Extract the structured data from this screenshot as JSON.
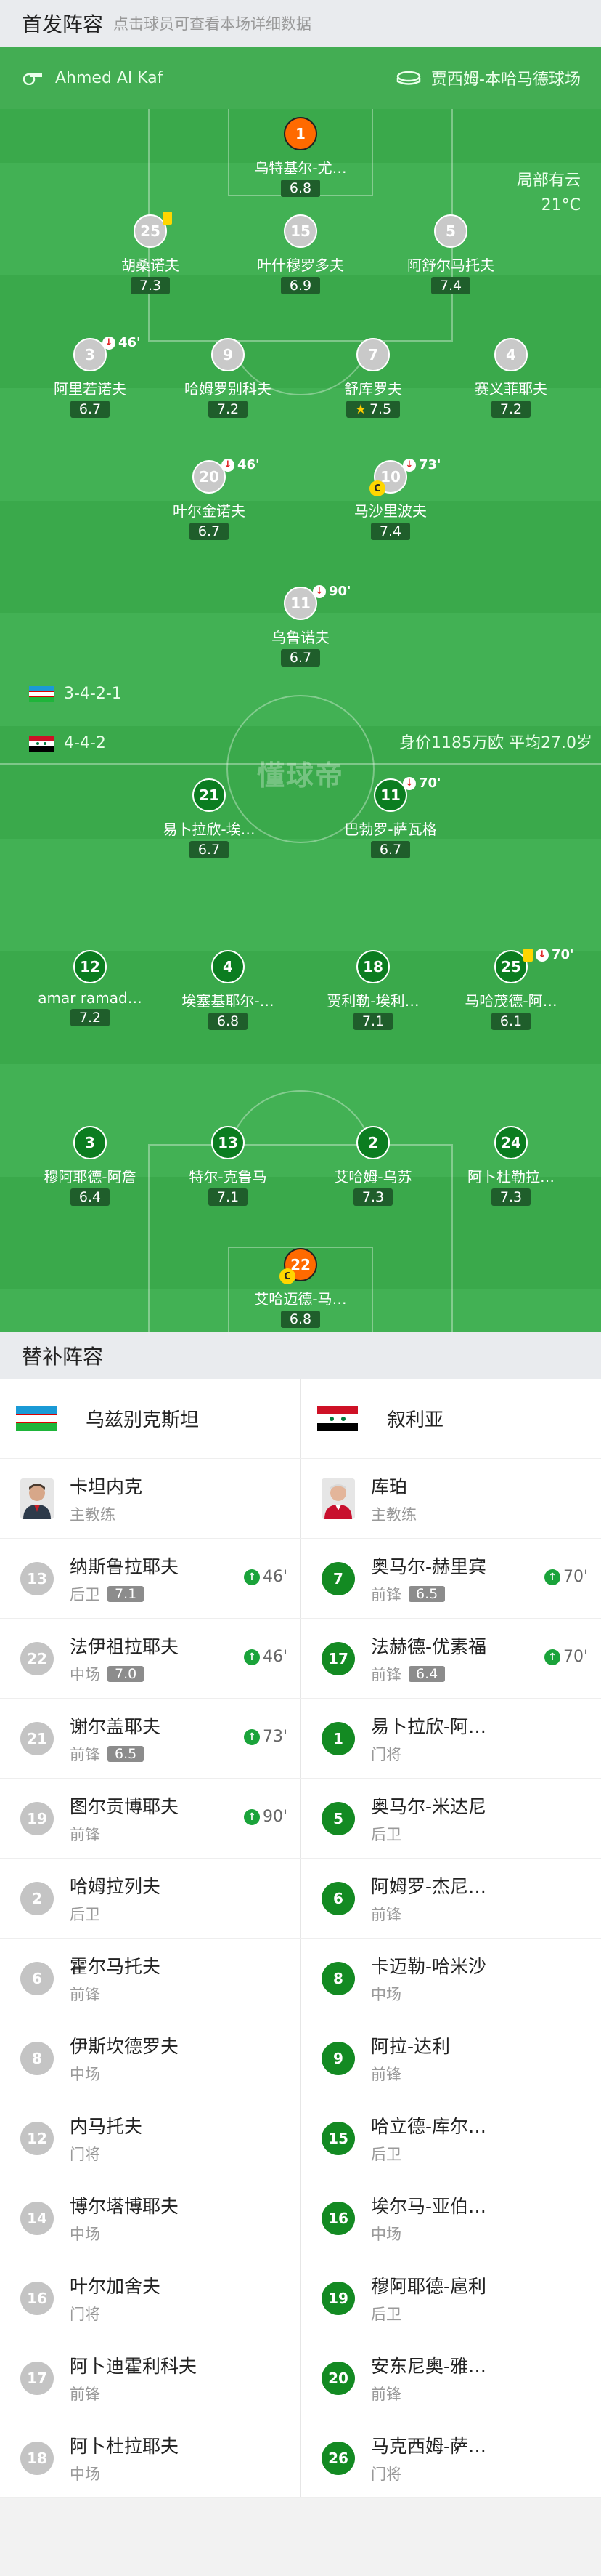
{
  "header": {
    "title": "首发阵容",
    "subtitle": "点击球员可查看本场详细数据"
  },
  "match_info": {
    "referee": "Ahmed Al Kaf",
    "stadium": "贾西姆-本哈马德球场",
    "weather": "局部有云",
    "temperature": "21°C"
  },
  "watermark": "懂球帝",
  "home": {
    "formation": "3-4-2-1",
    "value_text": "身价1185万欧  平均27.0岁",
    "players": [
      {
        "num": "1",
        "name": "乌特基尔-尤…",
        "rating": "6.8",
        "style": "orange"
      },
      {
        "num": "25",
        "name": "胡桑诺夫",
        "rating": "7.3",
        "style": "grey",
        "card": true
      },
      {
        "num": "15",
        "name": "叶什穆罗多夫",
        "rating": "6.9",
        "style": "grey"
      },
      {
        "num": "5",
        "name": "阿舒尔马托夫",
        "rating": "7.4",
        "style": "grey"
      },
      {
        "num": "3",
        "name": "阿里若诺夫",
        "rating": "6.7",
        "style": "grey",
        "sub": "46'"
      },
      {
        "num": "9",
        "name": "哈姆罗别科夫",
        "rating": "7.2",
        "style": "grey"
      },
      {
        "num": "7",
        "name": "舒库罗夫",
        "rating": "7.5",
        "style": "grey",
        "star": true
      },
      {
        "num": "4",
        "name": "赛义菲耶夫",
        "rating": "7.2",
        "style": "grey"
      },
      {
        "num": "20",
        "name": "叶尔金诺夫",
        "rating": "6.7",
        "style": "grey",
        "sub": "46'"
      },
      {
        "num": "10",
        "name": "马沙里波夫",
        "rating": "7.4",
        "style": "grey",
        "sub": "73'",
        "captain": true
      },
      {
        "num": "11",
        "name": "乌鲁诺夫",
        "rating": "6.7",
        "style": "grey",
        "sub": "90'"
      }
    ]
  },
  "away": {
    "formation": "4-4-2",
    "players": [
      {
        "num": "21",
        "name": "易卜拉欣-埃…",
        "rating": "6.7",
        "style": "green"
      },
      {
        "num": "11",
        "name": "巴勃罗-萨瓦格",
        "rating": "6.7",
        "style": "green",
        "sub": "70'"
      },
      {
        "num": "12",
        "name": "amar ramad…",
        "rating": "7.2",
        "style": "green"
      },
      {
        "num": "4",
        "name": "埃塞基耶尔-…",
        "rating": "6.8",
        "style": "green"
      },
      {
        "num": "18",
        "name": "贾利勒-埃利…",
        "rating": "7.1",
        "style": "green"
      },
      {
        "num": "25",
        "name": "马哈茂德-阿…",
        "rating": "6.1",
        "style": "green",
        "card": true,
        "sub": "70'"
      },
      {
        "num": "3",
        "name": "穆阿耶德-阿詹",
        "rating": "6.4",
        "style": "green"
      },
      {
        "num": "13",
        "name": "特尔-克鲁马",
        "rating": "7.1",
        "style": "green"
      },
      {
        "num": "2",
        "name": "艾哈姆-乌苏",
        "rating": "7.3",
        "style": "green"
      },
      {
        "num": "24",
        "name": "阿卜杜勒拉…",
        "rating": "7.3",
        "style": "green"
      },
      {
        "num": "22",
        "name": "艾哈迈德-马…",
        "rating": "6.8",
        "style": "orange",
        "captain": true
      }
    ]
  },
  "subs": {
    "title": "替补阵容",
    "home_team": "乌兹别克斯坦",
    "away_team": "叙利亚",
    "home_coach": {
      "name": "卡坦内克",
      "role": "主教练"
    },
    "away_coach": {
      "name": "库珀",
      "role": "主教练"
    },
    "rows": [
      [
        {
          "num": "13",
          "name": "纳斯鲁拉耶夫",
          "pos": "后卫",
          "rating": "7.1",
          "in": "46'"
        },
        {
          "num": "7",
          "name": "奥马尔-赫里宾",
          "pos": "前锋",
          "rating": "6.5",
          "in": "70'"
        }
      ],
      [
        {
          "num": "22",
          "name": "法伊祖拉耶夫",
          "pos": "中场",
          "rating": "7.0",
          "in": "46'"
        },
        {
          "num": "17",
          "name": "法赫德-优素福",
          "pos": "前锋",
          "rating": "6.4",
          "in": "70'"
        }
      ],
      [
        {
          "num": "21",
          "name": "谢尔盖耶夫",
          "pos": "前锋",
          "rating": "6.5",
          "in": "73'"
        },
        {
          "num": "1",
          "name": "易卜拉欣-阿…",
          "pos": "门将"
        }
      ],
      [
        {
          "num": "19",
          "name": "图尔贡博耶夫",
          "pos": "前锋",
          "in": "90'"
        },
        {
          "num": "5",
          "name": "奥马尔-米达尼",
          "pos": "后卫"
        }
      ],
      [
        {
          "num": "2",
          "name": "哈姆拉列夫",
          "pos": "后卫"
        },
        {
          "num": "6",
          "name": "阿姆罗-杰尼…",
          "pos": "前锋"
        }
      ],
      [
        {
          "num": "6",
          "name": "霍尔马托夫",
          "pos": "前锋"
        },
        {
          "num": "8",
          "name": "卡迈勒-哈米沙",
          "pos": "中场"
        }
      ],
      [
        {
          "num": "8",
          "name": "伊斯坎德罗夫",
          "pos": "中场"
        },
        {
          "num": "9",
          "name": "阿拉-达利",
          "pos": "前锋"
        }
      ],
      [
        {
          "num": "12",
          "name": "内马托夫",
          "pos": "门将"
        },
        {
          "num": "15",
          "name": "哈立德-库尔…",
          "pos": "后卫"
        }
      ],
      [
        {
          "num": "14",
          "name": "博尔塔博耶夫",
          "pos": "中场"
        },
        {
          "num": "16",
          "name": "埃尔马-亚伯…",
          "pos": "中场"
        }
      ],
      [
        {
          "num": "16",
          "name": "叶尔加舍夫",
          "pos": "门将"
        },
        {
          "num": "19",
          "name": "穆阿耶德-扈利",
          "pos": "后卫"
        }
      ],
      [
        {
          "num": "17",
          "name": "阿卜迪霍利科夫",
          "pos": "前锋"
        },
        {
          "num": "20",
          "name": "安东尼奥-雅…",
          "pos": "前锋"
        }
      ],
      [
        {
          "num": "18",
          "name": "阿卜杜拉耶夫",
          "pos": "中场"
        },
        {
          "num": "26",
          "name": "马克西姆-萨…",
          "pos": "门将"
        }
      ]
    ]
  }
}
